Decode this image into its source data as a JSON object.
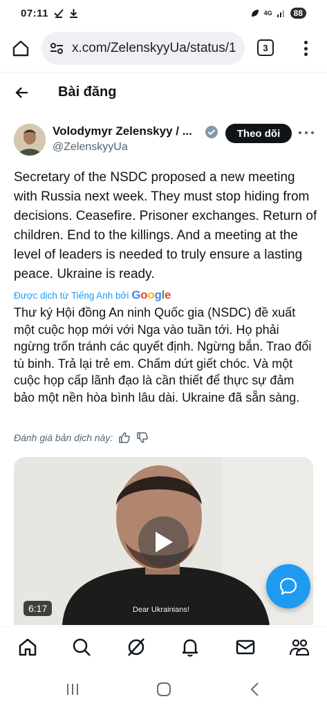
{
  "status_bar": {
    "time": "07:11",
    "network": "4G",
    "battery": "88"
  },
  "browser": {
    "url": "x.com/ZelenskyyUa/status/1",
    "tab_count": "3"
  },
  "header": {
    "title": "Bài đăng"
  },
  "author": {
    "name": "Volodymyr Zelenskyy / ...",
    "handle": "@ZelenskyyUa",
    "follow_label": "Theo dõi"
  },
  "post": {
    "text": "Secretary of the NSDC proposed a new meeting with Russia next week. They must stop hiding from decisions. Ceasefire. Prisoner exchanges. Return of children. End to the killings. And a meeting at the level of leaders is needed to truly ensure a lasting peace.  Ukraine is ready.",
    "translated_by": "Được dịch từ Tiếng Anh bởi",
    "translation": "Thư ký Hội đồng An ninh Quốc gia (NSDC) đề xuất một cuộc họp mới với Nga vào tuần tới. Họ phải ngừng trốn tránh các quyết định. Ngừng bắn. Trao đổi tù binh. Trả lại trẻ em. Chấm dứt giết chóc. Và một cuộc họp cấp lãnh đạo là cần thiết để thực sự đảm bảo một nền hòa bình lâu dài. Ukraine đã sẵn sàng.",
    "rate_label": "Đánh giá bản dịch này:"
  },
  "video": {
    "duration": "6:17",
    "subtitle": "Dear Ukrainians!"
  },
  "colors": {
    "accent": "#1d9bf0",
    "text_primary": "#0f1419",
    "text_secondary": "#536471"
  }
}
